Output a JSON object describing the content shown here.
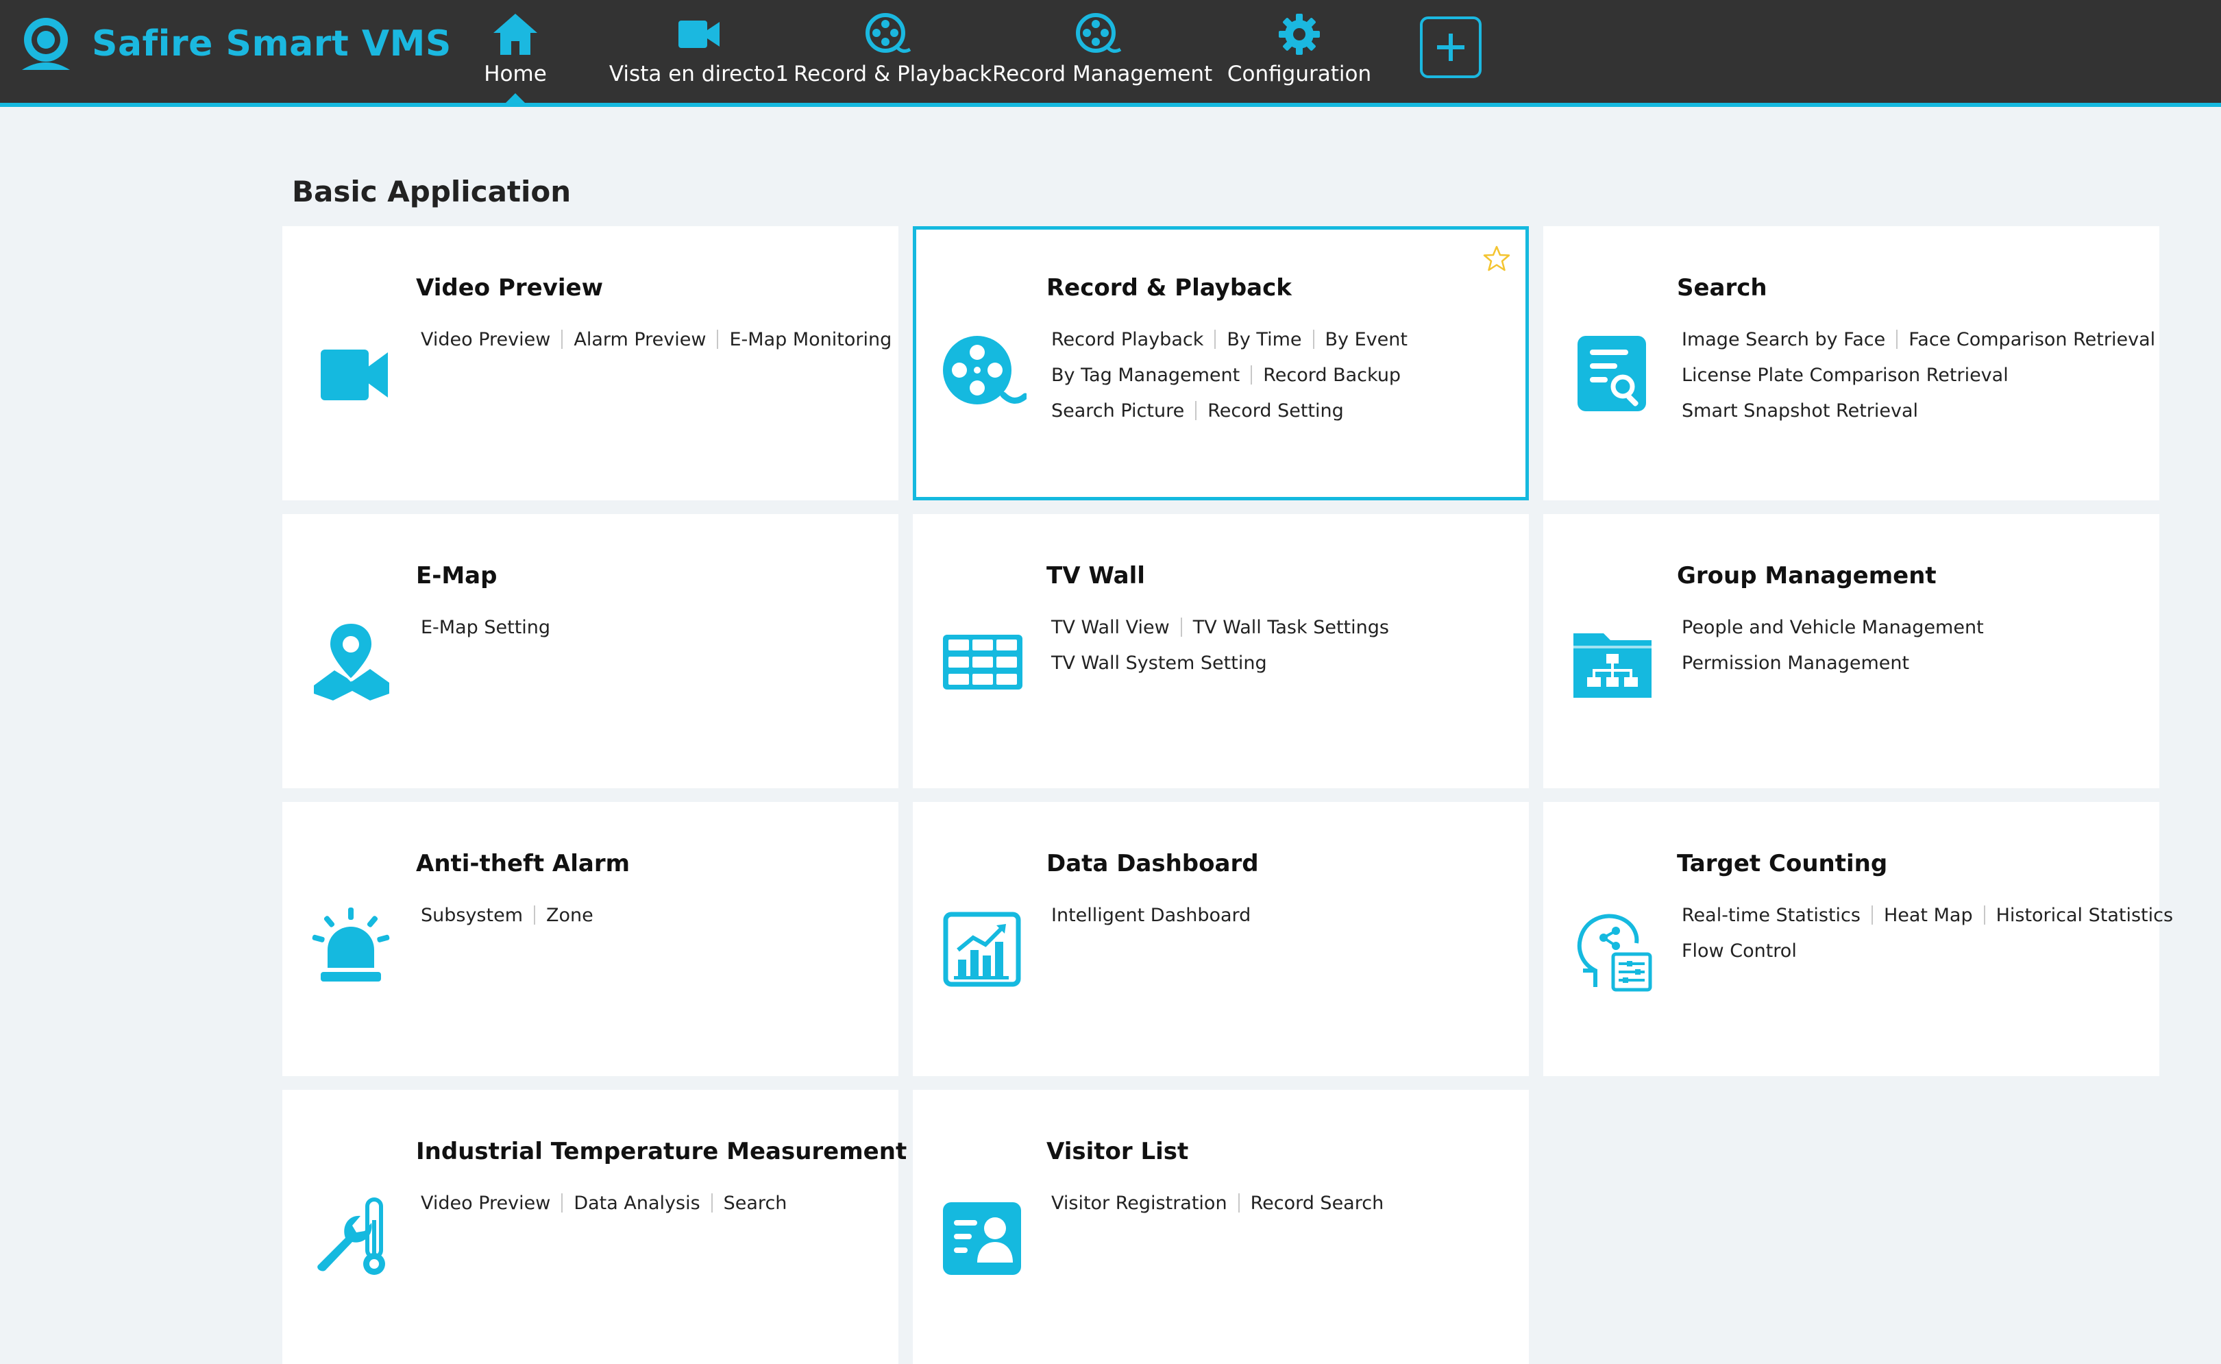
{
  "app": {
    "title": "Safire Smart VMS"
  },
  "colors": {
    "accent": "#15b9df",
    "topbar": "#333333",
    "background": "#eff3f6",
    "star": "#f4c430"
  },
  "nav": {
    "items": [
      {
        "label": "Home",
        "icon": "home-icon",
        "active": true
      },
      {
        "label": "Vista en directo1",
        "icon": "video-camera-icon"
      },
      {
        "label": "Record & Playback",
        "icon": "film-reel-icon"
      },
      {
        "label": "Record Management",
        "icon": "film-reel-icon"
      },
      {
        "label": "Configuration",
        "icon": "gear-icon"
      }
    ],
    "add_icon": "plus-icon"
  },
  "main": {
    "section_title": "Basic Application",
    "cards": [
      {
        "title": "Video Preview",
        "icon": "video-camera-icon",
        "links": [
          [
            "Video Preview",
            "Alarm Preview",
            "E-Map Monitoring"
          ]
        ]
      },
      {
        "title": "Record & Playback",
        "icon": "film-reel-icon",
        "selected": true,
        "favorite_icon": "star-icon",
        "links": [
          [
            "Record Playback",
            "By Time",
            "By Event"
          ],
          [
            "By Tag Management",
            "Record Backup"
          ],
          [
            "Search Picture",
            "Record Setting"
          ]
        ]
      },
      {
        "title": "Search",
        "icon": "document-search-icon",
        "links": [
          [
            "Image Search by Face",
            "Face Comparison Retrieval"
          ],
          [
            "License Plate Comparison Retrieval"
          ],
          [
            "Smart Snapshot Retrieval"
          ]
        ]
      },
      {
        "title": "E-Map",
        "icon": "map-pin-icon",
        "links": [
          [
            "E-Map Setting"
          ]
        ]
      },
      {
        "title": "TV Wall",
        "icon": "video-wall-icon",
        "links": [
          [
            "TV Wall View",
            "TV Wall Task Settings"
          ],
          [
            "TV Wall System Setting"
          ]
        ]
      },
      {
        "title": "Group Management",
        "icon": "folder-hierarchy-icon",
        "links": [
          [
            "People and Vehicle Management"
          ],
          [
            "Permission Management"
          ]
        ]
      },
      {
        "title": "Anti-theft Alarm",
        "icon": "alarm-siren-icon",
        "links": [
          [
            "Subsystem",
            "Zone"
          ]
        ]
      },
      {
        "title": "Data Dashboard",
        "icon": "dashboard-chart-icon",
        "links": [
          [
            "Intelligent Dashboard"
          ]
        ]
      },
      {
        "title": "Target Counting",
        "icon": "head-analytics-icon",
        "links": [
          [
            "Real-time Statistics",
            "Heat Map",
            "Historical Statistics"
          ],
          [
            "Flow Control"
          ]
        ]
      },
      {
        "title": "Industrial Temperature Measurement",
        "icon": "wrench-thermometer-icon",
        "links": [
          [
            "Video Preview",
            "Data Analysis",
            "Search"
          ]
        ]
      },
      {
        "title": "Visitor List",
        "icon": "visitor-card-icon",
        "links": [
          [
            "Visitor Registration",
            "Record Search"
          ]
        ]
      }
    ]
  }
}
